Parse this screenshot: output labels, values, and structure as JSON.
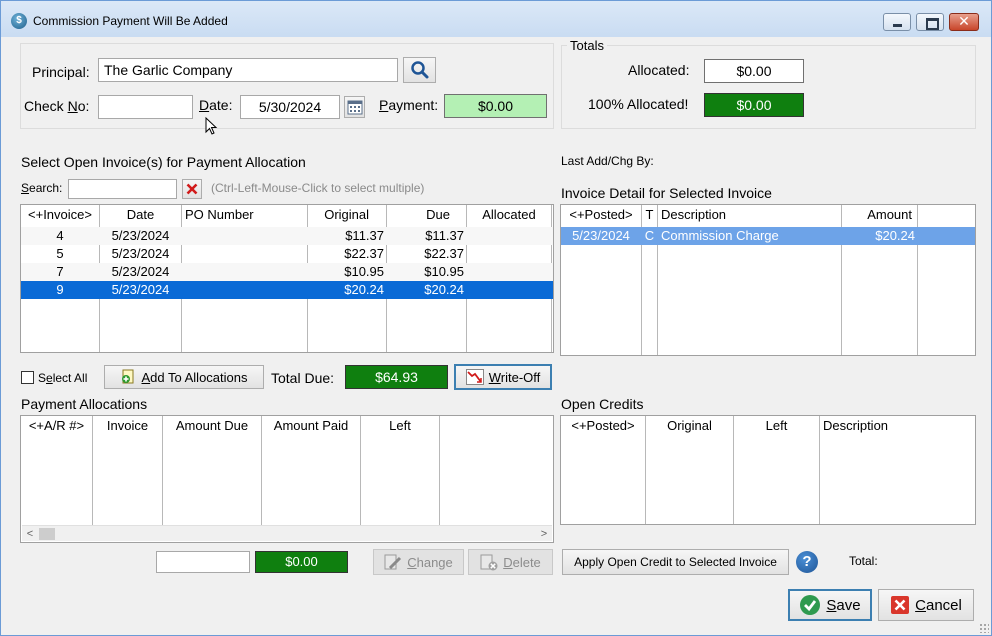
{
  "window": {
    "title": "Commission Payment Will Be Added",
    "app_icon_glyph": "$"
  },
  "header": {
    "principal_label": "Principal:",
    "principal_value": "The Garlic Company",
    "check_no_label_prefix": "Check ",
    "check_no_label_underline": "N",
    "check_no_label_suffix": "o:",
    "check_no_value": "",
    "date_label_prefix": "",
    "date_label_underline": "D",
    "date_label_suffix": "ate:",
    "date_value": "5/30/2024",
    "payment_label_underline": "P",
    "payment_label_suffix": "ayment:",
    "payment_value": "$0.00"
  },
  "totals": {
    "group_title": "Totals",
    "allocated_label": "Allocated:",
    "allocated_value": "$0.00",
    "full_allocated_label": "100% Allocated!",
    "full_allocated_value": "$0.00"
  },
  "open_invoices": {
    "title": "Select Open Invoice(s) for Payment Allocation",
    "search_label_underline": "S",
    "search_label_suffix": "earch:",
    "search_value": "",
    "hint": "(Ctrl-Left-Mouse-Click to select multiple)",
    "columns": [
      "<+Invoice>",
      "Date",
      "PO Number",
      "Original",
      "Due",
      "Allocated"
    ],
    "rows": [
      {
        "invoice": "4",
        "date": "5/23/2024",
        "po": "",
        "original": "$11.37",
        "due": "$11.37",
        "allocated": ""
      },
      {
        "invoice": "5",
        "date": "5/23/2024",
        "po": "",
        "original": "$22.37",
        "due": "$22.37",
        "allocated": ""
      },
      {
        "invoice": "7",
        "date": "5/23/2024",
        "po": "",
        "original": "$10.95",
        "due": "$10.95",
        "allocated": ""
      },
      {
        "invoice": "9",
        "date": "5/23/2024",
        "po": "",
        "original": "$20.24",
        "due": "$20.24",
        "allocated": ""
      }
    ],
    "selected_index": 3,
    "select_all_label_prefix": "S",
    "select_all_label_underline": "e",
    "select_all_label_suffix": "lect All",
    "add_button_label_underline": "A",
    "add_button_label_suffix": "dd To Allocations",
    "total_due_label": "Total Due:",
    "total_due_value": "$64.93",
    "write_off_label_underline": "W",
    "write_off_label_suffix": "rite-Off"
  },
  "invoice_detail": {
    "last_add_label": "Last Add/Chg By:",
    "title": "Invoice Detail for Selected Invoice",
    "columns": [
      "<+Posted>",
      "T",
      "Description",
      "Amount"
    ],
    "rows": [
      {
        "posted": "5/23/2024",
        "t": "C",
        "description": "Commission Charge",
        "amount": "$20.24"
      }
    ]
  },
  "payment_allocations": {
    "title": "Payment Allocations",
    "columns": [
      "<+A/R #>",
      "Invoice",
      "Amount Due",
      "Amount Paid",
      "Left"
    ],
    "scroll_left": "<",
    "scroll_right": ">"
  },
  "open_credits": {
    "title": "Open Credits",
    "columns": [
      "<+Posted>",
      "Original",
      "Left",
      "Description"
    ]
  },
  "bottom": {
    "amount_input_value": "",
    "amount_value": "$0.00",
    "change_label_underline": "C",
    "change_label_suffix": "hange",
    "delete_label_underline": "D",
    "delete_label_suffix": "elete",
    "apply_credit_label": "Apply Open Credit to Selected Invoice",
    "help_glyph": "?",
    "total_label": "Total:",
    "save_label_underline": "S",
    "save_label_suffix": "ave",
    "cancel_label_underline": "C",
    "cancel_label_suffix": "ancel"
  },
  "colors": {
    "selected_row": "#0a6ad6",
    "selected_detail_row": "#6da3e8",
    "green_dark": "#0f7f0f",
    "green_light": "#b4f0b4"
  }
}
